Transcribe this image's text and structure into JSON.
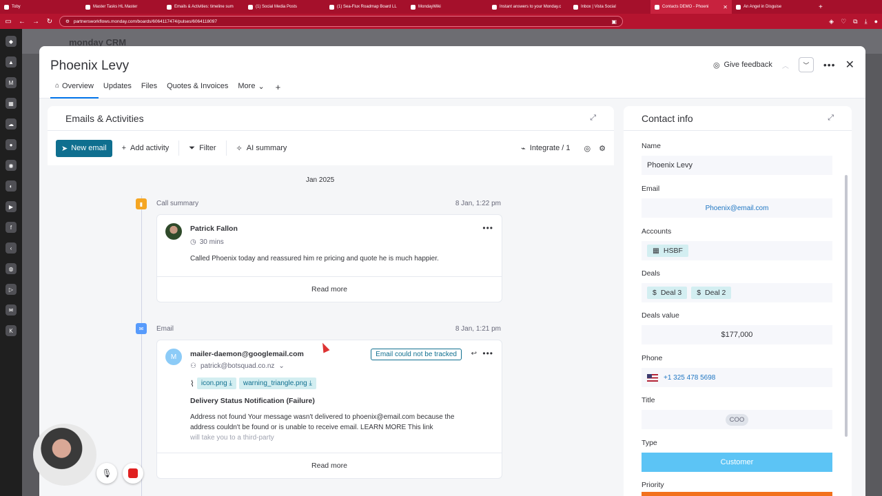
{
  "browser": {
    "tabs": [
      {
        "title": "Toby",
        "active": false
      },
      {
        "title": "Master Tasks HL Master",
        "active": false
      },
      {
        "title": "Emails & Activities: timeline sum",
        "active": false
      },
      {
        "title": "(1) Social Media Posts",
        "active": false
      },
      {
        "title": "(1) Sea-Flux Roadmap Board LL",
        "active": false
      },
      {
        "title": "MondayWiki",
        "active": false
      },
      {
        "title": "Instant answers to your Monday.c",
        "active": false
      },
      {
        "title": "Inbox | Vista Social",
        "active": false
      },
      {
        "title": "Contacts DEMO - Phoeni",
        "active": true
      },
      {
        "title": "An Angel in Disguise",
        "active": false
      }
    ],
    "url": "partnersworkflows.monday.com/boards/6064117474/pulses/6064118097"
  },
  "background": {
    "logo": "monday CRM"
  },
  "contact": {
    "name": "Phoenix Levy",
    "feedback_label": "Give feedback",
    "tabs": [
      "Overview",
      "Updates",
      "Files",
      "Quotes & Invoices",
      "More"
    ]
  },
  "emails": {
    "title": "Emails & Activities",
    "toolbar": {
      "new_email": "New email",
      "add_activity": "Add activity",
      "filter": "Filter",
      "ai_summary": "AI summary",
      "integrate": "Integrate / 1"
    },
    "date_group": "Jan 2025",
    "call": {
      "type_label": "Call summary",
      "time": "8 Jan, 1:22 pm",
      "author": "Patrick Fallon",
      "duration": "30 mins",
      "body": "Called Phoenix today and reassured him re pricing and quote he is much happier.",
      "read_more": "Read more"
    },
    "email": {
      "type_label": "Email",
      "time": "8 Jan, 1:21 pm",
      "avatar_letter": "M",
      "sender": "mailer-daemon@googlemail.com",
      "status": "Email could not be tracked",
      "recipient": "patrick@botsquad.co.nz",
      "attachments": [
        "icon.png",
        "warning_triangle.png"
      ],
      "subject": "Delivery Status Notification (Failure)",
      "body_line1": "Address not found Your message wasn't delivered to phoenix@email.com because the",
      "body_line2": "address couldn't be found or is unable to receive email. LEARN MORE This link",
      "body_line3": "will take you to a third-party",
      "read_more": "Read more"
    }
  },
  "contact_info": {
    "title": "Contact info",
    "name_label": "Name",
    "name_value": "Phoenix Levy",
    "email_label": "Email",
    "email_value": "Phoenix@email.com",
    "accounts_label": "Accounts",
    "accounts": [
      "HSBF"
    ],
    "deals_label": "Deals",
    "deals": [
      "Deal 3",
      "Deal 2"
    ],
    "deals_value_label": "Deals value",
    "deals_value": "$177,000",
    "phone_label": "Phone",
    "phone_value": "+1 325 478 5698",
    "title_label": "Title",
    "title_value": "COO",
    "type_label": "Type",
    "type_value": "Customer",
    "priority_label": "Priority"
  },
  "colors": {
    "browser_chrome": "#a5102b",
    "primary_button": "#0f6f8f",
    "type_customer": "#5cc4f5",
    "priority": "#f2711c",
    "call_icon": "#f5a623",
    "email_icon": "#579bfc"
  }
}
